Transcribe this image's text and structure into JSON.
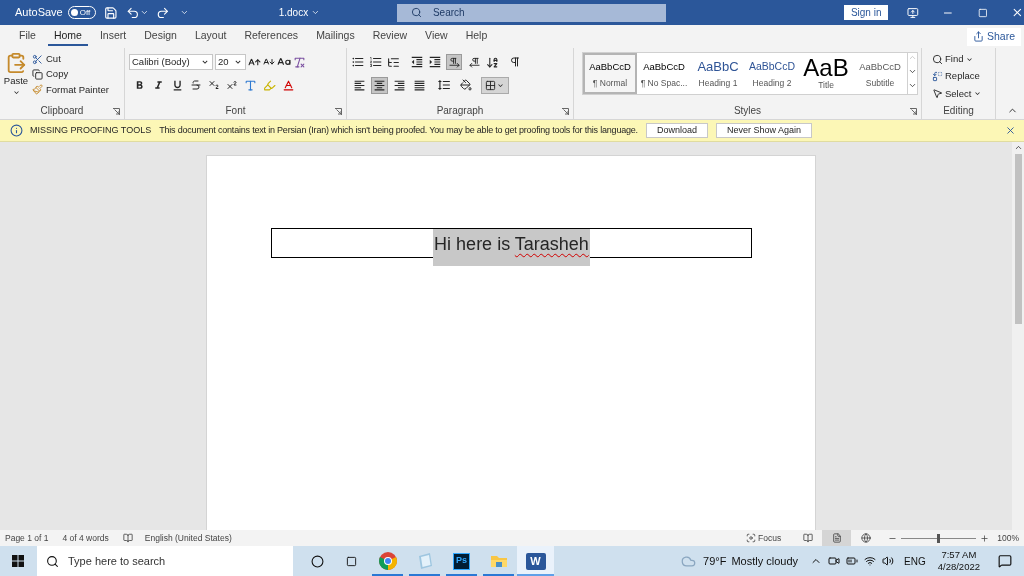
{
  "title_bar": {
    "autosave_label": "AutoSave",
    "autosave": {
      "on": false,
      "label": "Off"
    },
    "filename": "1.docx",
    "search_placeholder": "Search",
    "sign_in": "Sign in"
  },
  "tabs": [
    {
      "label": "File",
      "selected": false
    },
    {
      "label": "Home",
      "selected": true
    },
    {
      "label": "Insert",
      "selected": false
    },
    {
      "label": "Design",
      "selected": false
    },
    {
      "label": "Layout",
      "selected": false
    },
    {
      "label": "References",
      "selected": false
    },
    {
      "label": "Mailings",
      "selected": false
    },
    {
      "label": "Review",
      "selected": false
    },
    {
      "label": "View",
      "selected": false
    },
    {
      "label": "Help",
      "selected": false
    }
  ],
  "share": "Share",
  "clipboard": {
    "paste": "Paste",
    "cut": "Cut",
    "copy": "Copy",
    "format_painter": "Format Painter",
    "label": "Clipboard"
  },
  "font": {
    "font_name": "Calibri (Body)",
    "font_size": "20",
    "label": "Font"
  },
  "paragraph": {
    "label": "Paragraph",
    "direction": [
      {
        "kind": "ltr",
        "selected": true
      },
      {
        "kind": "rtl",
        "selected": false
      }
    ],
    "alignment": [
      {
        "kind": "left",
        "selected": false
      },
      {
        "kind": "center",
        "selected": true
      },
      {
        "kind": "right",
        "selected": false
      },
      {
        "kind": "justify",
        "selected": false
      }
    ]
  },
  "styles": {
    "label": "Styles",
    "items": [
      {
        "preview": "AaBbCcD",
        "name": "¶ Normal",
        "kind": "normal",
        "selected": true
      },
      {
        "preview": "AaBbCcD",
        "name": "¶ No Spac...",
        "kind": "normal",
        "selected": false
      },
      {
        "preview": "AaBbC",
        "name": "Heading 1",
        "kind": "heading1",
        "selected": false
      },
      {
        "preview": "AaBbCcD",
        "name": "Heading 2",
        "kind": "heading2",
        "selected": false
      },
      {
        "preview": "AaB",
        "name": "Title",
        "kind": "title",
        "selected": false
      },
      {
        "preview": "AaBbCcD",
        "name": "Subtitle",
        "kind": "subtitle",
        "selected": false
      }
    ]
  },
  "editing": {
    "label": "Editing",
    "find": "Find",
    "replace": "Replace",
    "select": "Select"
  },
  "info_bar": {
    "title": "MISSING PROOFING TOOLS",
    "message": "This document contains text in Persian (Iran) which isn't being proofed. You may be able to get proofing tools for this language.",
    "buttons": [
      "Download",
      "Never Show Again"
    ]
  },
  "document": {
    "selected": true,
    "parts": [
      {
        "text": "Hi here is ",
        "misspelled": false
      },
      {
        "text": "Tarasheh",
        "misspelled": true
      }
    ]
  },
  "status_bar": {
    "page": "Page 1 of 1",
    "words": "4 of 4 words",
    "language": "English (United States)",
    "focus": "Focus",
    "views": [
      {
        "kind": "read",
        "selected": false
      },
      {
        "kind": "print",
        "selected": true
      },
      {
        "kind": "web",
        "selected": false
      }
    ],
    "zoom": {
      "level": 0.5,
      "reading": "100%"
    }
  },
  "taskbar": {
    "search_placeholder": "Type here to search",
    "apps": [
      {
        "kind": "chrome",
        "running": true,
        "selected": false
      },
      {
        "kind": "notes",
        "running": true,
        "selected": false
      },
      {
        "kind": "photoshop",
        "glyph": "Ps",
        "running": true,
        "selected": false
      },
      {
        "kind": "files",
        "running": true,
        "selected": false
      },
      {
        "kind": "word",
        "glyph": "W",
        "running": true,
        "selected": true
      }
    ],
    "temperature": "79°F",
    "weather": "Mostly cloudy",
    "language": "ENG",
    "time": "7:57 AM",
    "date": "4/28/2022"
  }
}
